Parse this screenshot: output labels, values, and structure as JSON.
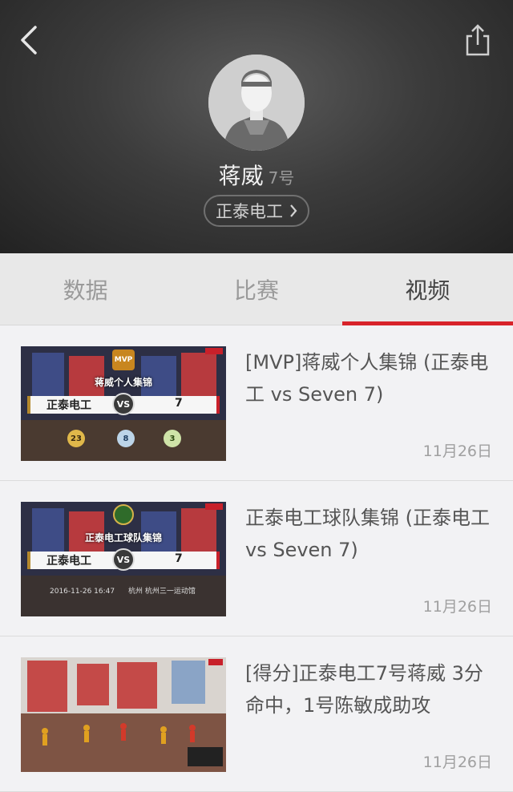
{
  "header": {
    "player_name": "蒋威",
    "player_number": "7号",
    "team_label": "正泰电工"
  },
  "tabs": [
    {
      "label": "数据",
      "active": false
    },
    {
      "label": "比赛",
      "active": false
    },
    {
      "label": "视频",
      "active": true
    }
  ],
  "accent_color": "#d8232a",
  "videos": [
    {
      "title": "[MVP]蒋威个人集锦 (正泰电工 vs Seven 7)",
      "date": "11月26日",
      "thumb": {
        "reel_title": "蒋威个人集锦",
        "badge": "MVP",
        "home_team": "正泰电工",
        "vs": "VS",
        "away_score": "7",
        "stats": [
          "23",
          "8",
          "3"
        ]
      }
    },
    {
      "title": "正泰电工球队集锦 (正泰电工 vs Seven 7)",
      "date": "11月26日",
      "thumb": {
        "reel_title": "正泰电工球队集锦",
        "home_team": "正泰电工",
        "vs": "VS",
        "away_score": "7",
        "meta_time": "2016-11-26 16:47",
        "meta_place": "杭州 杭州三一运动馆"
      }
    },
    {
      "title": "[得分]正泰电工7号蒋威 3分命中，1号陈敏成助攻",
      "date": "11月26日",
      "thumb": {}
    }
  ]
}
